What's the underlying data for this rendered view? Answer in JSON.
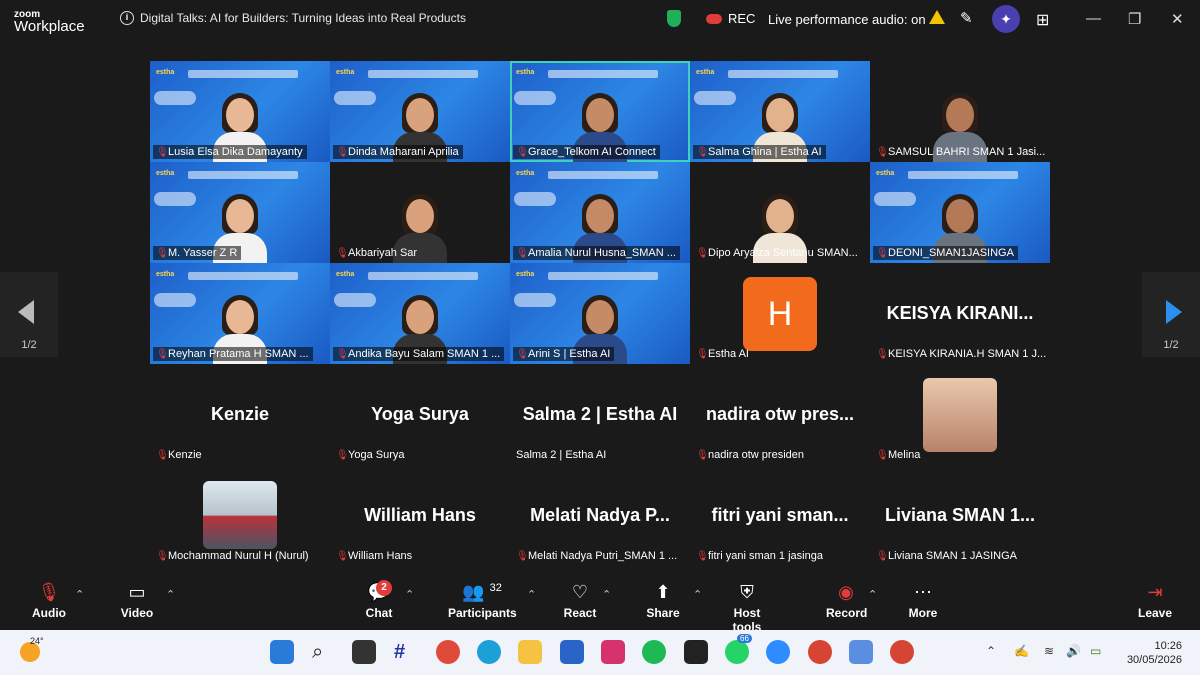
{
  "app": {
    "brand_top": "zoom",
    "brand_bottom": "Workplace"
  },
  "meeting": {
    "title": "Digital Talks: AI for Builders: Turning Ideas into Real Products",
    "rec_label": "REC",
    "live_audio": "Live performance audio: on"
  },
  "tiles": [
    {
      "name": "Lusia Elsa Dika Damayanty",
      "style": "blue"
    },
    {
      "name": "Dinda Maharani Aprilia",
      "style": "blue"
    },
    {
      "name": "Grace_Telkom AI Connect",
      "style": "blue",
      "active": true
    },
    {
      "name": "Salma Ghina | Estha AI",
      "style": "blue"
    },
    {
      "name": "SAMSUL BAHRI SMAN 1 Jasi...",
      "style": "dark"
    },
    {
      "name": "M. Yasser Z R",
      "style": "blue"
    },
    {
      "name": "Akbariyah Sar",
      "style": "dark"
    },
    {
      "name": "Amalia Nurul Husna_SMAN ...",
      "style": "blue"
    },
    {
      "name": "Dipo Aryalza Sentanu SMAN...",
      "style": "dark"
    },
    {
      "name": "DEONI_SMAN1JASINGA",
      "style": "blue"
    },
    {
      "name": "Reyhan Pratama H SMAN ...",
      "style": "blue"
    },
    {
      "name": "Andika Bayu Salam SMAN 1 ...",
      "style": "blue"
    },
    {
      "name": "Arini S | Estha AI",
      "style": "blue"
    },
    {
      "name": "Estha AI",
      "style": "avatar",
      "initial": "H"
    },
    {
      "name": "KEISYA KIRANIA.H SMAN 1 J...",
      "style": "text",
      "display": "KEISYA  KIRANI..."
    },
    {
      "name": "Kenzie",
      "style": "text",
      "display": "Kenzie"
    },
    {
      "name": "Yoga Surya",
      "style": "text",
      "display": "Yoga Surya"
    },
    {
      "name": "Salma 2 | Estha AI",
      "style": "text",
      "display": "Salma 2 | Estha AI",
      "nomic": true
    },
    {
      "name": "nadira otw presiden",
      "style": "text",
      "display": "nadira  otw  pres..."
    },
    {
      "name": "Melina",
      "style": "photo"
    },
    {
      "name": "Mochammad Nurul H (Nurul)",
      "style": "photo2"
    },
    {
      "name": "William Hans",
      "style": "text",
      "display": "William Hans"
    },
    {
      "name": "Melati Nadya Putri_SMAN 1 ...",
      "style": "text",
      "display": "Melati  Nadya  P..."
    },
    {
      "name": "fitri yani sman 1 jasinga",
      "style": "text",
      "display": "fitri  yani  sman..."
    },
    {
      "name": "Liviana SMAN 1 JASINGA",
      "style": "text",
      "display": "Liviana  SMAN  1..."
    }
  ],
  "banner_logo": "estha",
  "pager": {
    "left": "1/2",
    "right": "1/2"
  },
  "toolbar": {
    "audio": "Audio",
    "video": "Video",
    "chat": "Chat",
    "chat_badge": "2",
    "participants": "Participants",
    "participants_count": "32",
    "react": "React",
    "share": "Share",
    "host_tools": "Host tools",
    "record": "Record",
    "more": "More",
    "leave": "Leave"
  },
  "taskbar": {
    "temperature": "24°",
    "whatsapp_badge": "66",
    "time": "10:26",
    "date": "30/05/2026"
  },
  "colors": {
    "accent_active": "#3fd1c0",
    "record": "#e23b3b",
    "avatar_orange": "#f26b1d"
  }
}
